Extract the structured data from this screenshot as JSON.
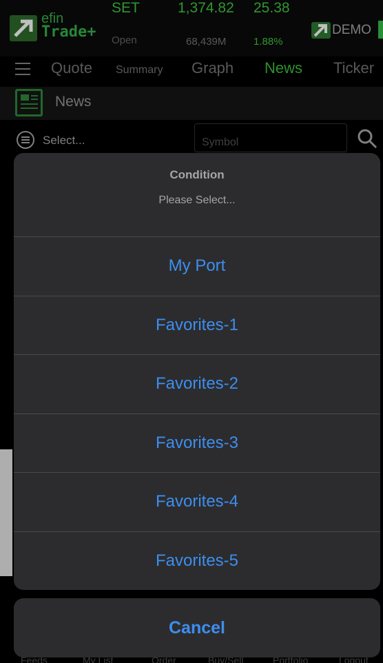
{
  "header": {
    "brand_top": "efin",
    "brand_bottom": "Trade+",
    "market": "SET",
    "market_status": "Open",
    "index_value": "1,374.82",
    "index_volume": "68,439M",
    "index_change": "25.38",
    "index_pct": "1.88%",
    "demo_label": "DEMO"
  },
  "tabs": [
    {
      "label": "Quote"
    },
    {
      "label": "Summary"
    },
    {
      "label": "Graph"
    },
    {
      "label": "News"
    },
    {
      "label": "Ticker"
    }
  ],
  "page": {
    "title": "News"
  },
  "filter": {
    "select_label": "Select...",
    "symbol_placeholder": "Symbol"
  },
  "bottom_nav": [
    {
      "label": "Feeds"
    },
    {
      "label": "My List"
    },
    {
      "label": "Order"
    },
    {
      "label": "Buy/Sell"
    },
    {
      "label": "Portfolio"
    },
    {
      "label": "Logout"
    }
  ],
  "action_sheet": {
    "title": "Condition",
    "message": "Please Select...",
    "options": [
      {
        "label": "My Port"
      },
      {
        "label": "Favorites-1"
      },
      {
        "label": "Favorites-2"
      },
      {
        "label": "Favorites-3"
      },
      {
        "label": "Favorites-4"
      },
      {
        "label": "Favorites-5"
      }
    ],
    "cancel_label": "Cancel"
  },
  "colors": {
    "accent_green": "#40c840",
    "ios_blue": "#3d8ef0",
    "sheet_bg": "#2c2c2e"
  }
}
